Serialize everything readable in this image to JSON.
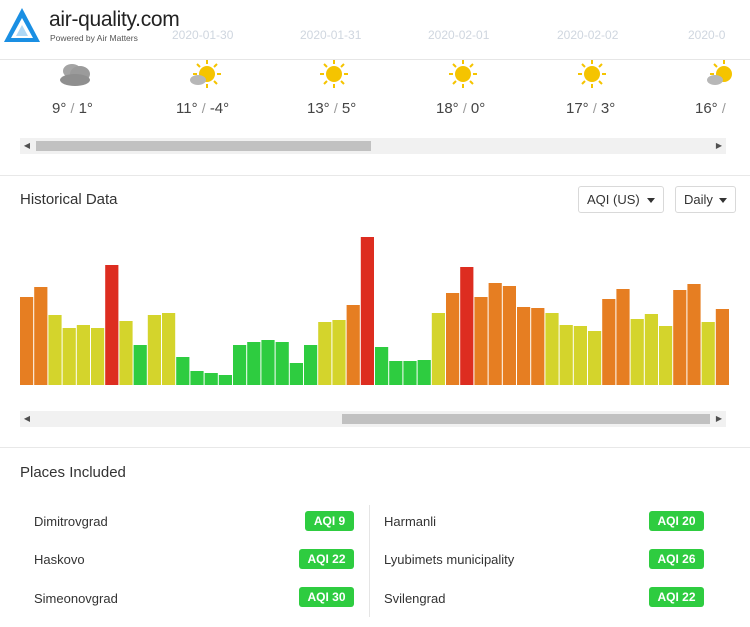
{
  "header": {
    "brand": "air-quality.com",
    "tagline": "Powered by Air Matters",
    "faded_dates": [
      "2020-01-30",
      "2020-01-31",
      "2020-02-01",
      "2020-02-02",
      "2020-0"
    ]
  },
  "forecast": {
    "days": [
      {
        "icon": "cloudy-icon",
        "high": "9°",
        "low": "1°"
      },
      {
        "icon": "partly-sunny-icon",
        "high": "11°",
        "low": "-4°"
      },
      {
        "icon": "sunny-icon",
        "high": "13°",
        "low": "5°"
      },
      {
        "icon": "sunny-icon",
        "high": "18°",
        "low": "0°"
      },
      {
        "icon": "sunny-icon",
        "high": "17°",
        "low": "3°"
      },
      {
        "icon": "partly-sunny-icon",
        "high": "16°",
        "low": ""
      }
    ],
    "separator": "/"
  },
  "historical": {
    "title": "Historical Data",
    "metric_selected": "AQI (US)",
    "period_selected": "Daily"
  },
  "chart_data": {
    "type": "bar",
    "colors": {
      "good": "#2ecc40",
      "moderate": "#d4d42c",
      "usg": "#e67e22",
      "unhealthy": "#dd2d20"
    },
    "ylim": [
      0,
      160
    ],
    "values": [
      88,
      98,
      70,
      57,
      60,
      57,
      120,
      64,
      40,
      70,
      72,
      28,
      14,
      12,
      10,
      40,
      43,
      45,
      43,
      22,
      40,
      63,
      65,
      80,
      148,
      38,
      24,
      24,
      25,
      72,
      92,
      118,
      88,
      102,
      99,
      78,
      77,
      72,
      60,
      59,
      54,
      86,
      96,
      66,
      71,
      59,
      95,
      101,
      63,
      76
    ],
    "categories_hidden": true
  },
  "places": {
    "title": "Places Included",
    "left": [
      {
        "name": "Dimitrovgrad",
        "aqi": "AQI 9"
      },
      {
        "name": "Haskovo",
        "aqi": "AQI 22"
      },
      {
        "name": "Simeonovgrad",
        "aqi": "AQI 30"
      }
    ],
    "right": [
      {
        "name": "Harmanli",
        "aqi": "AQI 20"
      },
      {
        "name": "Lyubimets municipality",
        "aqi": "AQI 26"
      },
      {
        "name": "Svilengrad",
        "aqi": "AQI 22"
      }
    ]
  }
}
